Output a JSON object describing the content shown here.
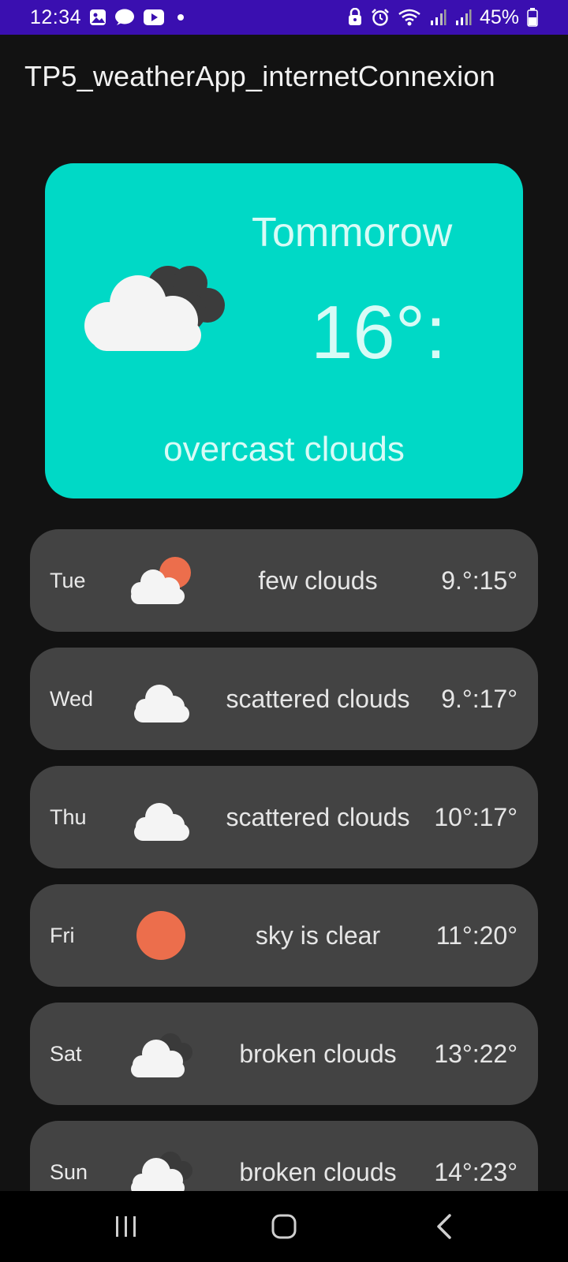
{
  "status_bar": {
    "time": "12:34",
    "battery": "45%",
    "left_icons": [
      "gallery-icon",
      "chat-icon",
      "youtube-icon",
      "dot-icon"
    ],
    "right_icons": [
      "lock-icon",
      "alarm-icon",
      "wifi-icon",
      "signal-icon",
      "signal-icon",
      "battery-icon"
    ]
  },
  "app_bar": {
    "title": "TP5_weatherApp_internetConnexion"
  },
  "hero": {
    "day": "Tommorow",
    "temperature": "16°:",
    "description": "overcast clouds",
    "icon": "overcast-clouds-icon",
    "background": "#00d9c6"
  },
  "forecast": [
    {
      "day": "Tue",
      "description": "few clouds",
      "temperature": "9.°:15°",
      "icon": "few-clouds-icon"
    },
    {
      "day": "Wed",
      "description": "scattered clouds",
      "temperature": "9.°:17°",
      "icon": "scattered-clouds-icon"
    },
    {
      "day": "Thu",
      "description": "scattered clouds",
      "temperature": "10°:17°",
      "icon": "scattered-clouds-icon"
    },
    {
      "day": "Fri",
      "description": "sky is clear",
      "temperature": "11°:20°",
      "icon": "clear-sky-icon"
    },
    {
      "day": "Sat",
      "description": "broken clouds",
      "temperature": "13°:22°",
      "icon": "broken-clouds-icon"
    },
    {
      "day": "Sun",
      "description": "broken clouds",
      "temperature": "14°:23°",
      "icon": "broken-clouds-icon"
    }
  ],
  "nav_bar": {
    "buttons": [
      "recent-apps-icon",
      "home-icon",
      "back-icon"
    ]
  },
  "colors": {
    "status_bar": "#3a0fb0",
    "background": "#121212",
    "card": "#434343",
    "accent": "#00d9c6",
    "sun": "#ec6e4c"
  }
}
